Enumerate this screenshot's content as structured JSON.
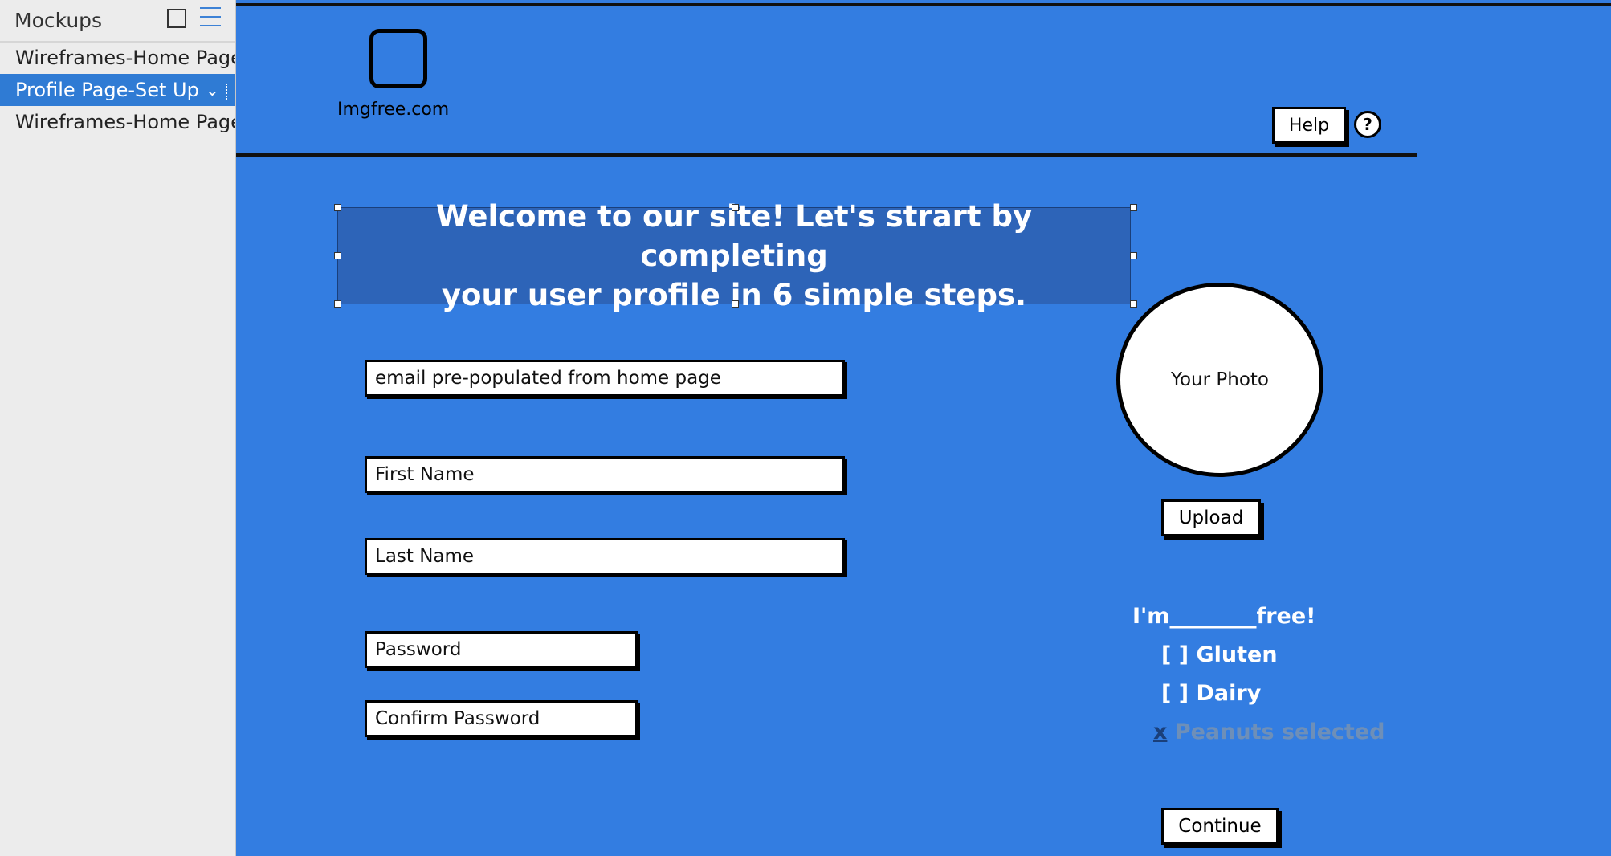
{
  "sidebar": {
    "title": "Mockups",
    "items": [
      {
        "label": "Wireframes-Home Page"
      },
      {
        "label": "Profile Page-Set Up"
      },
      {
        "label": "Wireframes-Home Page"
      }
    ]
  },
  "header": {
    "logo_text": "Imgfree.com",
    "help_label": "Help",
    "help_icon_glyph": "?"
  },
  "banner": {
    "line1": "Welcome to our site! Let's strart by completing",
    "line2": "your user profile in 6 simple steps."
  },
  "form": {
    "email": "email pre-populated from home page",
    "first_name": "First Name",
    "last_name": "Last Name",
    "password": "Password",
    "confirm_password": "Confirm Password"
  },
  "photo": {
    "label": "Your Photo",
    "upload_label": "Upload"
  },
  "allergies": {
    "prompt": "I'm________free!",
    "options": [
      {
        "mark": "[ ]",
        "label": "Gluten"
      },
      {
        "mark": "[ ]",
        "label": "Dairy"
      },
      {
        "mark": "x",
        "label": "Peanuts selected"
      }
    ]
  },
  "continue_label": "Continue",
  "colors": {
    "canvas": "#337de1",
    "banner": "#2d64b8",
    "sidebar_active": "#2f7bd4"
  }
}
